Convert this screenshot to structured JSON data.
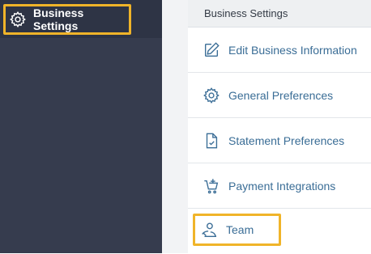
{
  "sidebar": {
    "active_item": {
      "label": "Business Settings",
      "icon": "gear-icon"
    }
  },
  "panel": {
    "header": "Business Settings",
    "items": [
      {
        "label": "Edit Business Information",
        "icon": "edit-icon"
      },
      {
        "label": "General Preferences",
        "icon": "gear-icon"
      },
      {
        "label": "Statement Preferences",
        "icon": "document-check-icon"
      },
      {
        "label": "Payment Integrations",
        "icon": "cart-add-icon"
      },
      {
        "label": "Team",
        "icon": "team-icon"
      }
    ]
  },
  "colors": {
    "sidebar_bg": "#363c4e",
    "highlight": "#f0b429",
    "link": "#3a6d96"
  }
}
